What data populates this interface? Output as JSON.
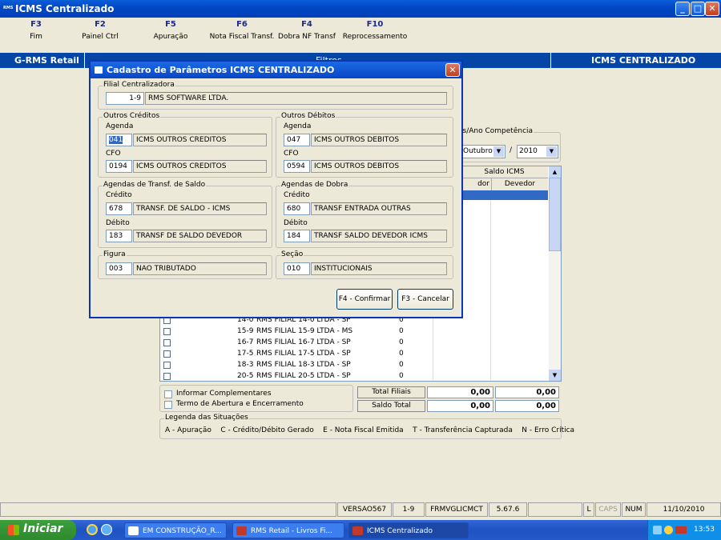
{
  "window": {
    "title": "ICMS Centralizado",
    "logo": "RMS"
  },
  "toolbar": [
    {
      "key": "F3",
      "label": "Fim"
    },
    {
      "key": "F2",
      "label": "Painel Ctrl"
    },
    {
      "key": "F5",
      "label": "Apuração"
    },
    {
      "key": "F6",
      "label": "Nota Fiscal Transf."
    },
    {
      "key": "F4",
      "label": "Dobra NF Transf"
    },
    {
      "key": "F10",
      "label": "Reprocessamento"
    }
  ],
  "band": {
    "left": "G-RMS Retail",
    "middle": "Filtros",
    "right": "ICMS CENTRALIZADO"
  },
  "competencia": {
    "label": "es/Ano Competência",
    "month": "Outubro",
    "year": "2010"
  },
  "grid": {
    "header_group": "Saldo ICMS",
    "col_credor": "dor",
    "col_devedor": "Devedor",
    "rows": [
      {
        "code": "14-0",
        "name": "RMS FILIAL 14-0 LTDA - SP",
        "value": "0"
      },
      {
        "code": "15-9",
        "name": "RMS FILIAL 15-9 LTDA - MS",
        "value": "0"
      },
      {
        "code": "16-7",
        "name": "RMS FILIAL 16-7 LTDA - SP",
        "value": "0"
      },
      {
        "code": "17-5",
        "name": "RMS FILIAL 17-5 LTDA - SP",
        "value": "0"
      },
      {
        "code": "18-3",
        "name": "RMS FILIAL 18-3 LTDA - SP",
        "value": "0"
      },
      {
        "code": "20-5",
        "name": "RMS FILIAL 20-5 LTDA - SP",
        "value": "0"
      }
    ]
  },
  "options": {
    "complementares": "Informar Complementares",
    "termo": "Termo de Abertura e Encerramento"
  },
  "totals": {
    "filiais_label": "Total Filiais",
    "saldo_label": "Saldo Total",
    "filiais_1": "0,00",
    "filiais_2": "0,00",
    "saldo_1": "0,00",
    "saldo_2": "0,00"
  },
  "legend": {
    "title": "Legenda das Situações",
    "text": "A - Apuração    C - Crédito/Débito Gerado    E - Nota Fiscal Emitida    T - Transferência Capturada    N - Erro Crítica"
  },
  "dialog": {
    "title": "Cadastro de Parâmetros ICMS CENTRALIZADO",
    "filial": {
      "label": "Filial Centralizadora",
      "code": "1-9",
      "name": "RMS SOFTWARE LTDA."
    },
    "outros_creditos": {
      "label": "Outros Créditos",
      "agenda_label": "Agenda",
      "agenda_code": "041",
      "agenda_desc": "ICMS OUTROS CREDITOS",
      "cfo_label": "CFO",
      "cfo_code": "0194",
      "cfo_desc": "ICMS OUTROS CREDITOS"
    },
    "outros_debitos": {
      "label": "Outros Débitos",
      "agenda_label": "Agenda",
      "agenda_code": "047",
      "agenda_desc": "ICMS OUTROS DEBITOS",
      "cfo_label": "CFO",
      "cfo_code": "0594",
      "cfo_desc": "ICMS OUTROS DEBITOS"
    },
    "transf_saldo": {
      "label": "Agendas de Transf. de Saldo",
      "credito_label": "Crédito",
      "credito_code": "678",
      "credito_desc": "TRANSF. DE SALDO - ICMS",
      "debito_label": "Débito",
      "debito_code": "183",
      "debito_desc": "TRANSF DE SALDO DEVEDOR"
    },
    "dobra": {
      "label": "Agendas de Dobra",
      "credito_label": "Crédito",
      "credito_code": "680",
      "credito_desc": "TRANSF ENTRADA OUTRAS",
      "debito_label": "Débito",
      "debito_code": "184",
      "debito_desc": "TRANSF SALDO DEVEDOR ICMS"
    },
    "figura": {
      "label": "Figura",
      "code": "003",
      "desc": "NAO TRIBUTADO"
    },
    "secao": {
      "label": "Seção",
      "code": "010",
      "desc": "INSTITUCIONAIS"
    },
    "confirm_label": "F4 - Confirmar",
    "cancel_label": "F3 - Cancelar"
  },
  "statusbar": {
    "version": "VERSAO567",
    "filial": "1-9",
    "form": "FRMVGLICMCT",
    "build": "5.67.6",
    "l": "L",
    "caps": "CAPS",
    "num": "NUM",
    "date": "11/10/2010"
  },
  "taskbar": {
    "start": "Iniciar",
    "tasks": [
      "EM CONSTRUÇÃO_R...",
      "RMS Retail - Livros Fi...",
      "ICMS Centralizado"
    ],
    "clock": "13:53"
  }
}
